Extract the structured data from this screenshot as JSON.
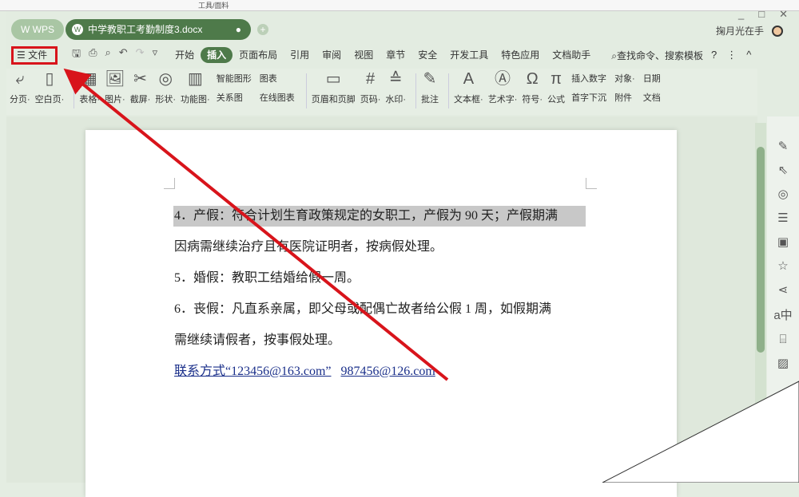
{
  "top_strip": {
    "label": "工具/面料"
  },
  "window": {
    "min": "_",
    "max": "□",
    "close": "✕"
  },
  "tabs": {
    "wps": "W WPS",
    "doc": "中学教职工考勤制度3.docx",
    "doc_dot": "●",
    "add": "+"
  },
  "user": {
    "name": "掬月光在手"
  },
  "menu": {
    "file": "☰ 文件",
    "items": [
      "开始",
      "插入",
      "页面布局",
      "引用",
      "审阅",
      "视图",
      "章节",
      "安全",
      "开发工具",
      "特色应用",
      "文档助手"
    ],
    "active": "插入",
    "search": "查找命令、搜索模板",
    "help": "?",
    "more": "⋮",
    "collapse": "^"
  },
  "ribbon": {
    "big": [
      {
        "icon": "⤶",
        "label": "分页·"
      },
      {
        "icon": "▯",
        "label": "空白页·"
      },
      {
        "icon": "▦",
        "label": "表格·"
      },
      {
        "icon": "🖼",
        "label": "图片·"
      },
      {
        "icon": "✂",
        "label": "截屏·"
      },
      {
        "icon": "◎",
        "label": "形状·"
      },
      {
        "icon": "▥",
        "label": "功能图·"
      }
    ],
    "small1": [
      "智能图形",
      "关系图"
    ],
    "small2": [
      "图表",
      "在线图表"
    ],
    "big2": [
      {
        "icon": "▭",
        "label": "页眉和页脚"
      },
      {
        "icon": "#",
        "label": "页码·"
      },
      {
        "icon": "≙",
        "label": "水印·"
      },
      {
        "icon": "✎",
        "label": "批注"
      },
      {
        "icon": "A",
        "label": "文本框·"
      },
      {
        "icon": "Ⓐ",
        "label": "艺术字·"
      },
      {
        "icon": "Ω",
        "label": "符号·"
      },
      {
        "icon": "π",
        "label": "公式"
      }
    ],
    "small3": [
      "插入数字",
      "首字下沉"
    ],
    "small4": [
      "对象·",
      "附件"
    ],
    "small5": [
      "日期",
      "文档"
    ]
  },
  "document": {
    "lines": [
      "4．产假：符合计划生育政策规定的女职工，产假为 90 天；产假期满",
      "因病需继续治疗且有医院证明者，按病假处理。",
      "5．婚假：教职工结婚给假一周。",
      "6．丧假：凡直系亲属，即父母或配偶亡故者给公假 1 周，如假期满",
      "需继续请假者，按事假处理。"
    ],
    "link1": "联系方式“123456@163.com”",
    "link2": "987456@126.com"
  },
  "colors": {
    "accent": "#4e7a4a",
    "annotation": "#d8141b"
  }
}
